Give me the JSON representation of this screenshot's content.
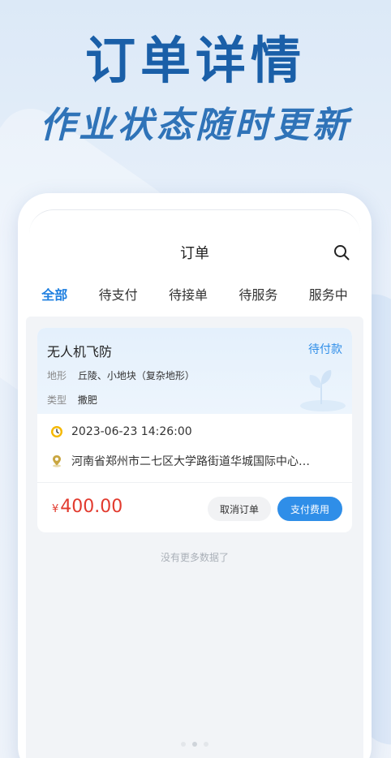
{
  "promo": {
    "title": "订单详情",
    "subtitle": "作业状态随时更新"
  },
  "navbar": {
    "title": "订单",
    "search_icon": "search-icon"
  },
  "tabs": [
    {
      "label": "全部",
      "active": true
    },
    {
      "label": "待支付",
      "active": false
    },
    {
      "label": "待接单",
      "active": false
    },
    {
      "label": "待服务",
      "active": false
    },
    {
      "label": "服务中",
      "active": false
    }
  ],
  "order": {
    "service_name": "无人机飞防",
    "status": "待付款",
    "terrain_key": "地形",
    "terrain_value": "丘陵、小地块（复杂地形）",
    "type_key": "类型",
    "type_value": "撒肥",
    "time": "2023-06-23 14:26:00",
    "address": "河南省郑州市二七区大学路街道华城国际中心…",
    "price_currency": "¥",
    "price_amount": "400.00",
    "cancel_label": "取消订单",
    "pay_label": "支付费用"
  },
  "list_footer": "没有更多数据了",
  "colors": {
    "accent": "#2f8ee8",
    "price": "#e23a2e",
    "headline": "#1a5fa8"
  }
}
